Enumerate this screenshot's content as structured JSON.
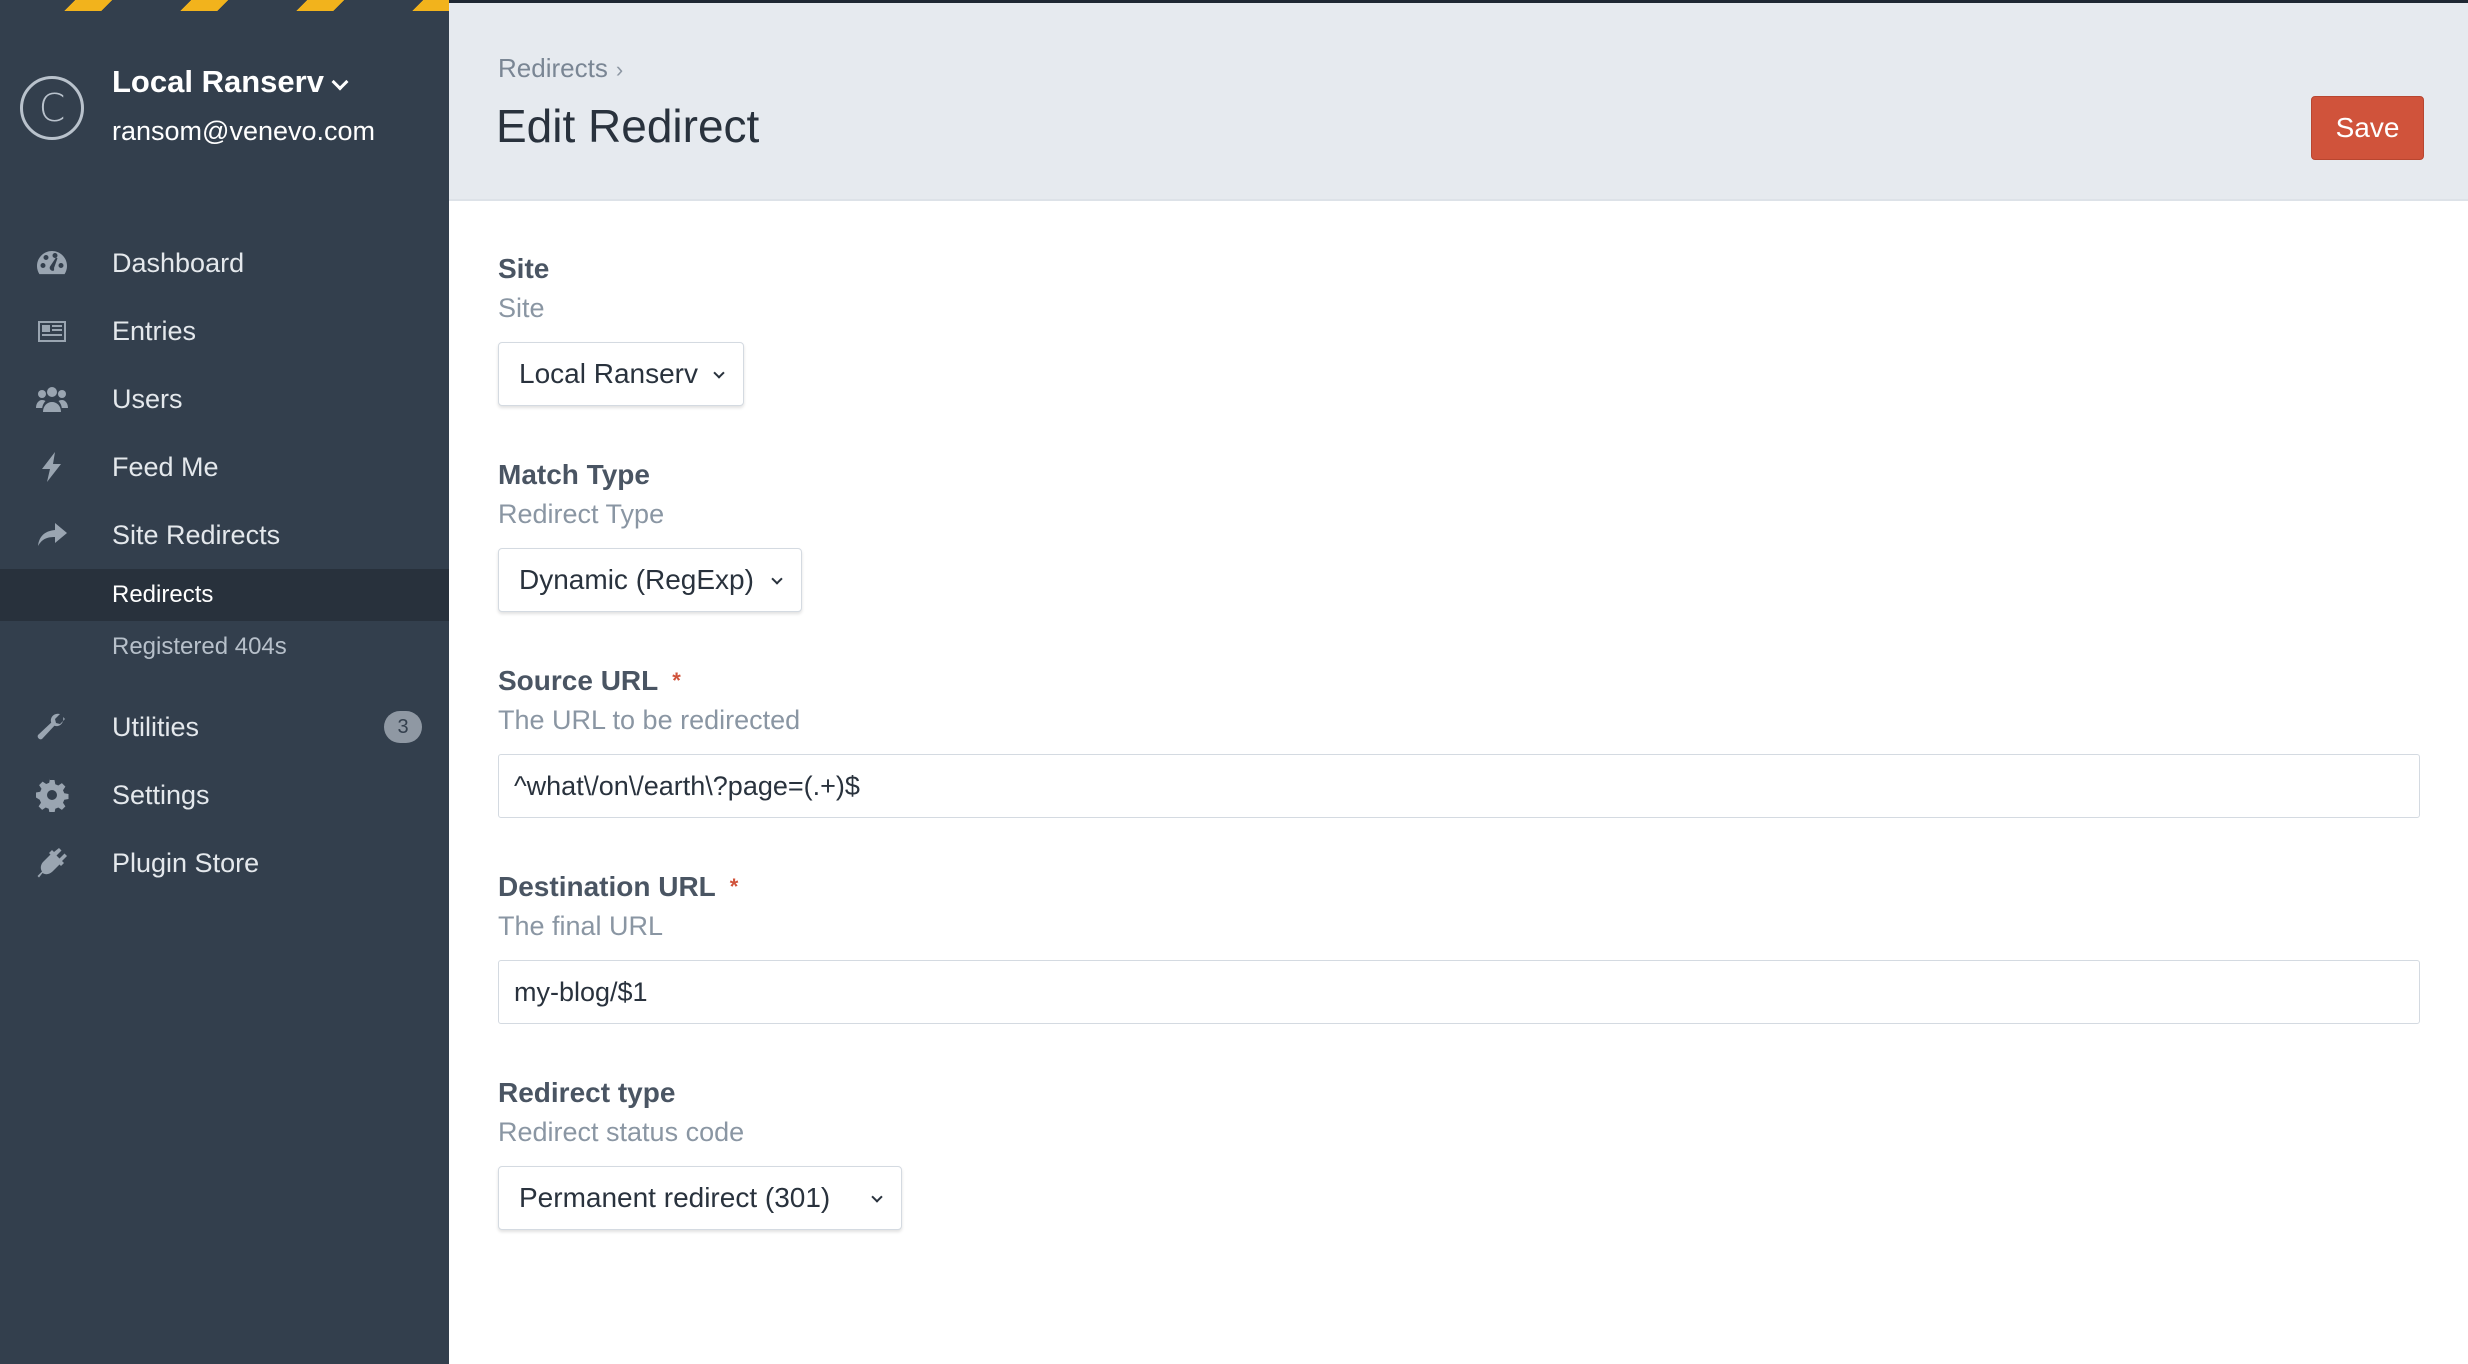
{
  "sidebar": {
    "account": {
      "logo_letter": "C",
      "site_name": "Local Ranserv",
      "email": "ransom@venevo.com"
    },
    "items": [
      {
        "label": "Dashboard",
        "icon": "dashboard-gauge-icon"
      },
      {
        "label": "Entries",
        "icon": "newspaper-icon"
      },
      {
        "label": "Users",
        "icon": "users-icon"
      },
      {
        "label": "Feed Me",
        "icon": "lightning-bolt-icon"
      },
      {
        "label": "Site Redirects",
        "icon": "share-arrow-icon"
      }
    ],
    "subitems": [
      {
        "label": "Redirects",
        "active": true
      },
      {
        "label": "Registered 404s",
        "active": false
      }
    ],
    "items_bottom": [
      {
        "label": "Utilities",
        "icon": "wrench-icon",
        "badge": "3"
      },
      {
        "label": "Settings",
        "icon": "gear-icon"
      },
      {
        "label": "Plugin Store",
        "icon": "plug-icon"
      }
    ]
  },
  "header": {
    "breadcrumb": "Redirects",
    "breadcrumb_sep": "›",
    "title": "Edit Redirect",
    "save_label": "Save"
  },
  "form": {
    "site": {
      "label": "Site",
      "help": "Site",
      "value": "Local Ranserv"
    },
    "match_type": {
      "label": "Match Type",
      "help": "Redirect Type",
      "value": "Dynamic (RegExp)"
    },
    "source_url": {
      "label": "Source URL",
      "required_mark": "*",
      "help": "The URL to be redirected",
      "value": "^what\\/on\\/earth\\?page=(.+)$"
    },
    "destination_url": {
      "label": "Destination URL",
      "required_mark": "*",
      "help": "The final URL",
      "value": "my-blog/$1"
    },
    "redirect_type": {
      "label": "Redirect type",
      "help": "Redirect status code",
      "value": "Permanent redirect (301)"
    }
  },
  "colors": {
    "sidebar_bg": "#333f4d",
    "header_bg": "#e6eaef",
    "accent": "#d0533b",
    "hazard_stripe": "#f2b31c"
  }
}
